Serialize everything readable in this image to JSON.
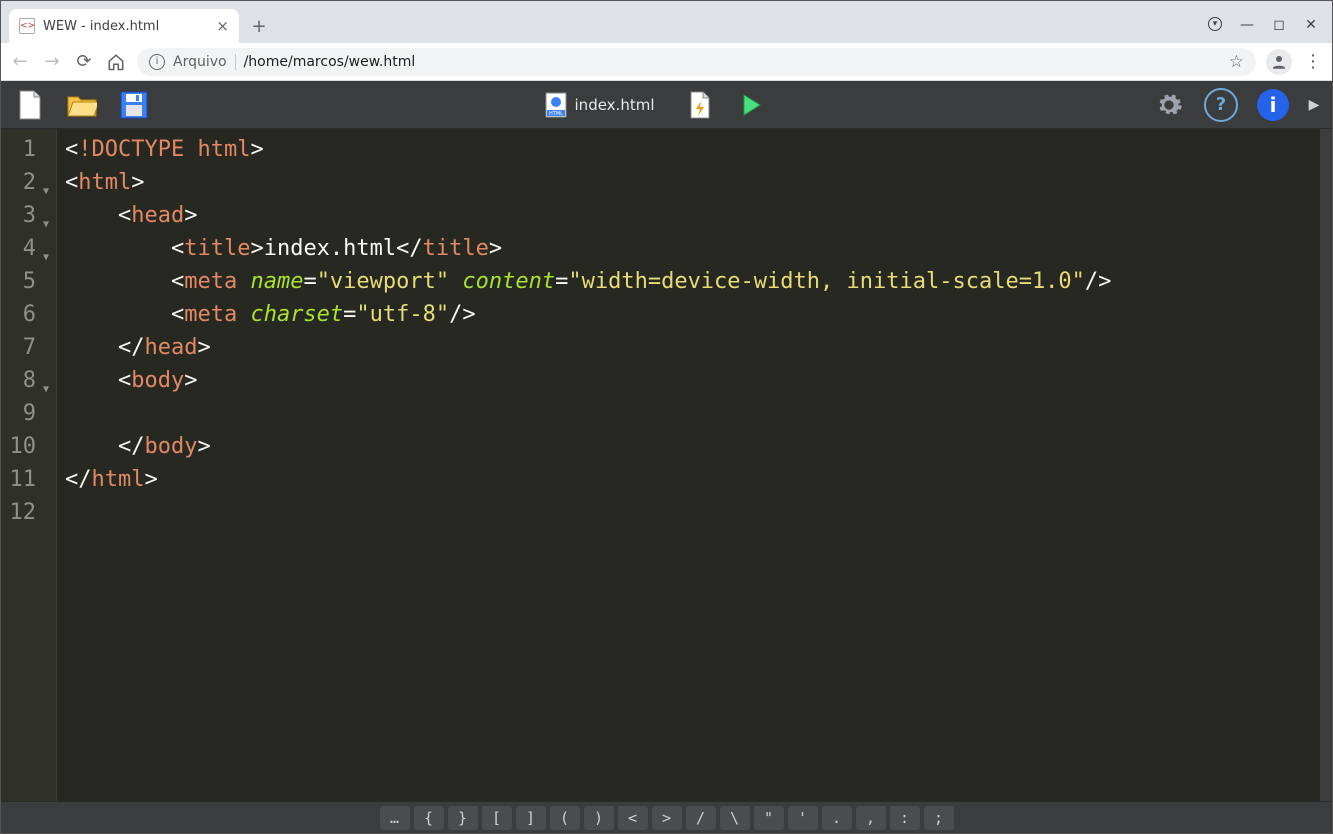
{
  "browser": {
    "tab_title": "WEW - index.html",
    "url_scheme_label": "Arquivo",
    "url_path": "/home/marcos/wew.html"
  },
  "toolbar": {
    "current_file": "index.html"
  },
  "editor": {
    "lines": [
      {
        "n": 1,
        "fold": false,
        "html": "<span class='t-bracket'>&lt;</span><span class='t-doctype'>!DOCTYPE html</span><span class='t-bracket'>&gt;</span>"
      },
      {
        "n": 2,
        "fold": true,
        "html": "<span class='t-bracket'>&lt;</span><span class='t-tag'>html</span><span class='t-bracket'>&gt;</span>"
      },
      {
        "n": 3,
        "fold": true,
        "html": "    <span class='t-bracket'>&lt;</span><span class='t-tag'>head</span><span class='t-bracket'>&gt;</span>"
      },
      {
        "n": 4,
        "fold": true,
        "html": "        <span class='t-bracket'>&lt;</span><span class='t-tag'>title</span><span class='t-bracket'>&gt;</span>index.html<span class='t-bracket'>&lt;/</span><span class='t-tag'>title</span><span class='t-bracket'>&gt;</span>"
      },
      {
        "n": 5,
        "fold": false,
        "html": "        <span class='t-bracket'>&lt;</span><span class='t-tag'>meta</span> <span class='t-attr'>name</span><span class='t-eq'>=</span><span class='t-str'>\"viewport\"</span> <span class='t-attr'>content</span><span class='t-eq'>=</span><span class='t-str'>\"width=device-width, initial-scale=1.0\"</span><span class='t-bracket'>/&gt;</span>"
      },
      {
        "n": 6,
        "fold": false,
        "html": "        <span class='t-bracket'>&lt;</span><span class='t-tag'>meta</span> <span class='t-attr'>charset</span><span class='t-eq'>=</span><span class='t-str'>\"utf-8\"</span><span class='t-bracket'>/&gt;</span>"
      },
      {
        "n": 7,
        "fold": false,
        "html": "    <span class='t-bracket'>&lt;/</span><span class='t-tag'>head</span><span class='t-bracket'>&gt;</span>"
      },
      {
        "n": 8,
        "fold": true,
        "html": "    <span class='t-bracket'>&lt;</span><span class='t-tag'>body</span><span class='t-bracket'>&gt;</span>"
      },
      {
        "n": 9,
        "fold": false,
        "html": ""
      },
      {
        "n": 10,
        "fold": false,
        "html": "    <span class='t-bracket'>&lt;/</span><span class='t-tag'>body</span><span class='t-bracket'>&gt;</span>"
      },
      {
        "n": 11,
        "fold": false,
        "html": "<span class='t-bracket'>&lt;/</span><span class='t-tag'>html</span><span class='t-bracket'>&gt;</span>"
      },
      {
        "n": 12,
        "fold": false,
        "html": ""
      }
    ]
  },
  "symbols": [
    "…",
    "{",
    "}",
    "[",
    "]",
    "(",
    ")",
    "<",
    ">",
    "/",
    "\\",
    "\"",
    "'",
    ".",
    ",",
    ":",
    ";"
  ]
}
